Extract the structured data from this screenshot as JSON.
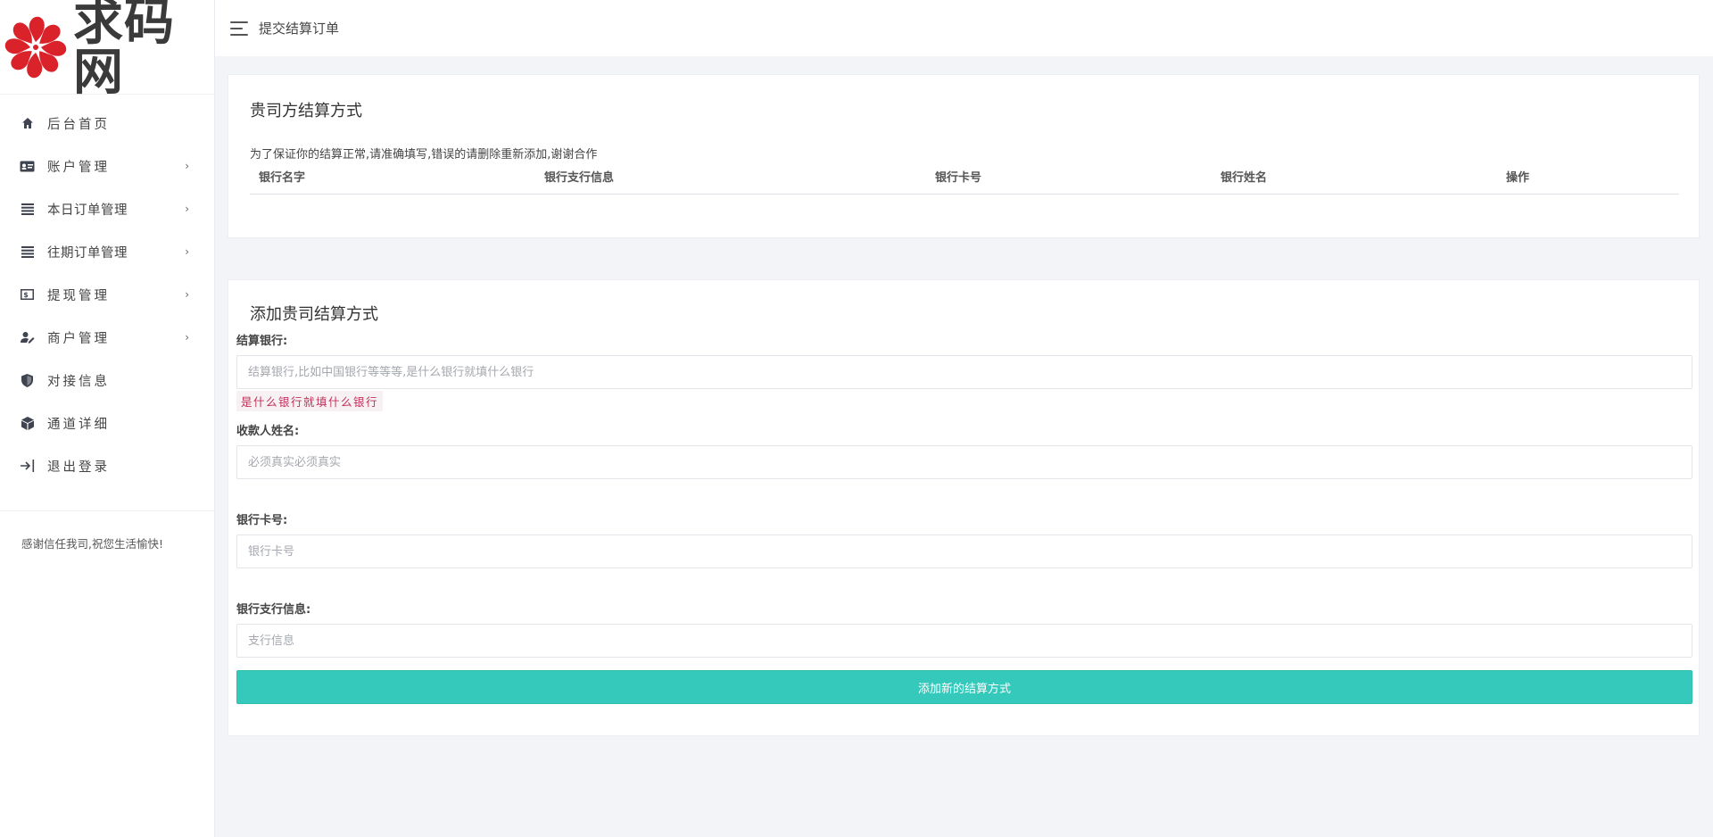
{
  "brand": {
    "logo_text": "求码网"
  },
  "topbar": {
    "title": "提交结算订单"
  },
  "sidebar": {
    "items": [
      {
        "label": "后台首页",
        "icon": "home-icon",
        "has_submenu": false
      },
      {
        "label": "账户管理",
        "icon": "id-card-icon",
        "has_submenu": true
      },
      {
        "label": "本日订单管理",
        "icon": "list-icon",
        "has_submenu": true
      },
      {
        "label": "往期订单管理",
        "icon": "list-icon",
        "has_submenu": true
      },
      {
        "label": "提现管理",
        "icon": "cash-icon",
        "has_submenu": true
      },
      {
        "label": "商户管理",
        "icon": "user-edit-icon",
        "has_submenu": true
      },
      {
        "label": "对接信息",
        "icon": "shield-icon",
        "has_submenu": false
      },
      {
        "label": "通道详细",
        "icon": "cube-icon",
        "has_submenu": false
      },
      {
        "label": "退出登录",
        "icon": "logout-icon",
        "has_submenu": false
      }
    ],
    "chevron": "›",
    "footer_text": "感谢信任我司,祝您生活愉快!"
  },
  "methods_panel": {
    "title": "贵司方结算方式",
    "notice": "为了保证你的结算正常,请准确填写,错误的请删除重新添加,谢谢合作",
    "columns": [
      "银行名字",
      "银行支行信息",
      "银行卡号",
      "银行姓名",
      "操作"
    ]
  },
  "add_panel": {
    "title": "添加贵司结算方式",
    "bank": {
      "label": "结算银行:",
      "placeholder": "结算银行,比如中国银行等等等,是什么银行就填什么银行",
      "hint": "是什么银行就填什么银行"
    },
    "name": {
      "label": "收款人姓名:",
      "placeholder": "必须真实必须真实"
    },
    "card": {
      "label": "银行卡号:",
      "placeholder": "银行卡号"
    },
    "branch": {
      "label": "银行支行信息:",
      "placeholder": "支行信息"
    },
    "submit_label": "添加新的结算方式"
  },
  "colors": {
    "accent": "#34c9bb",
    "hint_text": "#c0305a",
    "logo_red": "#d9222a"
  }
}
